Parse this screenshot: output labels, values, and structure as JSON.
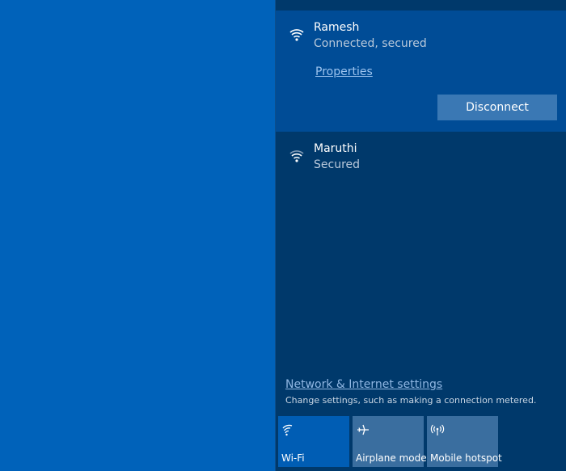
{
  "networks": [
    {
      "name": "Ramesh",
      "status": "Connected, secured",
      "properties_label": "Properties",
      "disconnect_label": "Disconnect"
    },
    {
      "name": "Maruthi",
      "status": "Secured"
    }
  ],
  "settings": {
    "link_label": "Network & Internet settings",
    "description": "Change settings, such as making a connection metered."
  },
  "quick_actions": [
    {
      "label": "Wi-Fi",
      "icon": "wifi-icon",
      "active": true
    },
    {
      "label": "Airplane mode",
      "icon": "airplane-icon",
      "active": false
    },
    {
      "label": "Mobile hotspot",
      "icon": "hotspot-icon",
      "active": false
    }
  ],
  "colors": {
    "desktop": "#0062ba",
    "flyout": "#00396b",
    "selected_network": "#004c96",
    "accent_active_tile": "#005db4"
  }
}
